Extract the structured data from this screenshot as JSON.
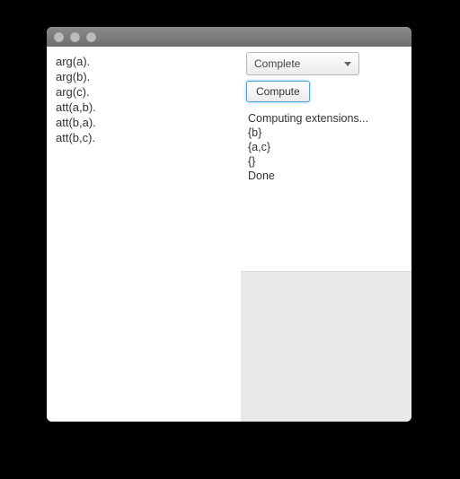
{
  "editor": {
    "lines": [
      "arg(a).",
      "arg(b).",
      "arg(c).",
      "att(a,b).",
      "att(b,a).",
      "att(b,c)."
    ]
  },
  "controls": {
    "semantics_selected": "Complete",
    "compute_label": "Compute"
  },
  "output": {
    "lines": [
      "Computing extensions...",
      "{b}",
      "{a,c}",
      "{}",
      "Done"
    ]
  }
}
